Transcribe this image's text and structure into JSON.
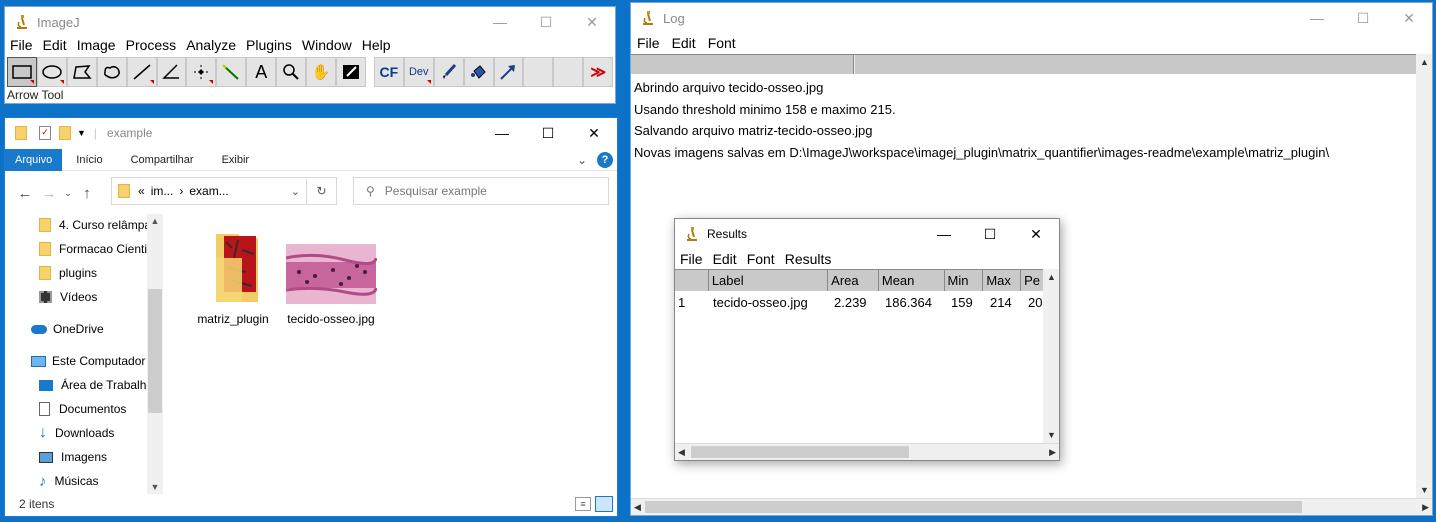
{
  "imagej": {
    "title": "ImageJ",
    "menu": [
      "File",
      "Edit",
      "Image",
      "Process",
      "Analyze",
      "Plugins",
      "Window",
      "Help"
    ],
    "status": "Arrow Tool",
    "tools": [
      "rectangle",
      "oval",
      "polygon",
      "freehand",
      "line",
      "angle",
      "multipoint",
      "wand",
      "text",
      "magnifier",
      "hand",
      "color-picker",
      "CF",
      "Dev",
      "brush",
      "flood-fill",
      "arrow",
      "blank",
      "blank",
      "more"
    ],
    "tool_labels": {
      "cf": "CF",
      "dev": "Dev",
      "text": "A",
      "more": "≫"
    }
  },
  "explorer": {
    "title": "example",
    "ribbon": [
      "Arquivo",
      "Início",
      "Compartilhar",
      "Exibir"
    ],
    "address": [
      "«",
      "im...",
      "›",
      "exam..."
    ],
    "search_placeholder": "Pesquisar example",
    "nav": [
      {
        "label": "4. Curso relâmpa",
        "icon": "folder"
      },
      {
        "label": "Formacao Cienti",
        "icon": "folder"
      },
      {
        "label": "plugins",
        "icon": "folder"
      },
      {
        "label": "Vídeos",
        "icon": "videos"
      },
      {
        "label": "OneDrive",
        "icon": "cloud"
      },
      {
        "label": "Este Computador",
        "icon": "computer"
      },
      {
        "label": "Área de Trabalho",
        "icon": "desktop"
      },
      {
        "label": "Documentos",
        "icon": "documents"
      },
      {
        "label": "Downloads",
        "icon": "downloads"
      },
      {
        "label": "Imagens",
        "icon": "pictures"
      },
      {
        "label": "Músicas",
        "icon": "music"
      }
    ],
    "files": [
      {
        "name": "matriz_plugin",
        "type": "folder"
      },
      {
        "name": "tecido-osseo.jpg",
        "type": "image"
      }
    ],
    "status": "2 itens"
  },
  "log": {
    "title": "Log",
    "menu": [
      "File",
      "Edit",
      "Font"
    ],
    "lines": [
      "Abrindo arquivo tecido-osseo.jpg",
      "Usando threshold minimo 158 e maximo 215.",
      "Salvando arquivo matriz-tecido-osseo.jpg",
      "Novas imagens salvas em D:\\ImageJ\\workspace\\imagej_plugin\\matrix_quantifier\\images-readme\\example\\matriz_plugin\\"
    ]
  },
  "results": {
    "title": "Results",
    "menu": [
      "File",
      "Edit",
      "Font",
      "Results"
    ],
    "columns": [
      "",
      "Label",
      "Area",
      "Mean",
      "Min",
      "Max",
      "Pe"
    ],
    "rows": [
      [
        "1",
        "tecido-osseo.jpg",
        "2.239",
        "186.364",
        "159",
        "214",
        "20"
      ]
    ]
  },
  "colors": {
    "desktop": "#0c72c8",
    "accent": "#1979ca"
  }
}
